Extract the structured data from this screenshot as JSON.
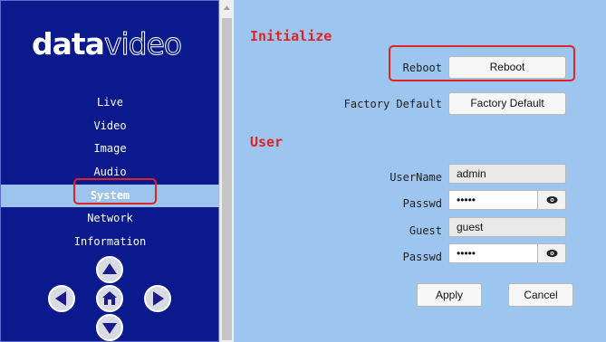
{
  "logo": {
    "part1": "data",
    "part2": "video"
  },
  "menu": {
    "items": [
      {
        "label": "Live"
      },
      {
        "label": "Video"
      },
      {
        "label": "Image"
      },
      {
        "label": "Audio"
      },
      {
        "label": "System",
        "active": true
      },
      {
        "label": "Network"
      },
      {
        "label": "Information"
      }
    ]
  },
  "dpad": {
    "up": "up-arrow-icon",
    "left": "left-arrow-icon",
    "home": "home-icon",
    "right": "right-arrow-icon",
    "down": "down-arrow-icon"
  },
  "initialize": {
    "title": "Initialize",
    "reboot_label": "Reboot",
    "reboot_button": "Reboot",
    "factory_label": "Factory Default",
    "factory_button": "Factory Default"
  },
  "user": {
    "title": "User",
    "username_label": "UserName",
    "username_value": "admin",
    "passwd_label": "Passwd",
    "passwd_value": "•••••",
    "guest_label": "Guest",
    "guest_value": "guest",
    "guest_passwd_label": "Passwd",
    "guest_passwd_value": "•••••"
  },
  "actions": {
    "apply": "Apply",
    "cancel": "Cancel"
  },
  "colors": {
    "sidebar": "#0a1a8c",
    "main_bg": "#9cc5ef",
    "accent": "#e02424",
    "active_item": "#9cc3ec"
  }
}
